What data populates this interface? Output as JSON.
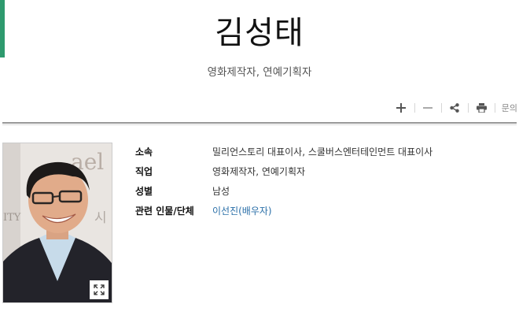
{
  "header": {
    "title": "김성태",
    "subtitle": "영화제작자, 연예기획자"
  },
  "toolbar": {
    "items": [
      {
        "icon": "plus-icon"
      },
      {
        "icon": "minus-icon"
      },
      {
        "icon": "share-icon"
      },
      {
        "icon": "print-icon"
      }
    ],
    "inquiry_label": "문의"
  },
  "profile": {
    "photo_text": "ael",
    "photo_text_2": "ITY",
    "photo_text_3": "시"
  },
  "info": {
    "rows": [
      {
        "label": "소속",
        "value": "밀리언스토리 대표이사, 스쿨버스엔터테인먼트 대표이사"
      },
      {
        "label": "직업",
        "value": "영화제작자, 연예기획자"
      },
      {
        "label": "성별",
        "value": "남성"
      },
      {
        "label": "관련 인물/단체",
        "value": "이선진(배우자)"
      }
    ]
  },
  "colors": {
    "accent": "#2e9a6e",
    "link": "#2a6fa8"
  }
}
